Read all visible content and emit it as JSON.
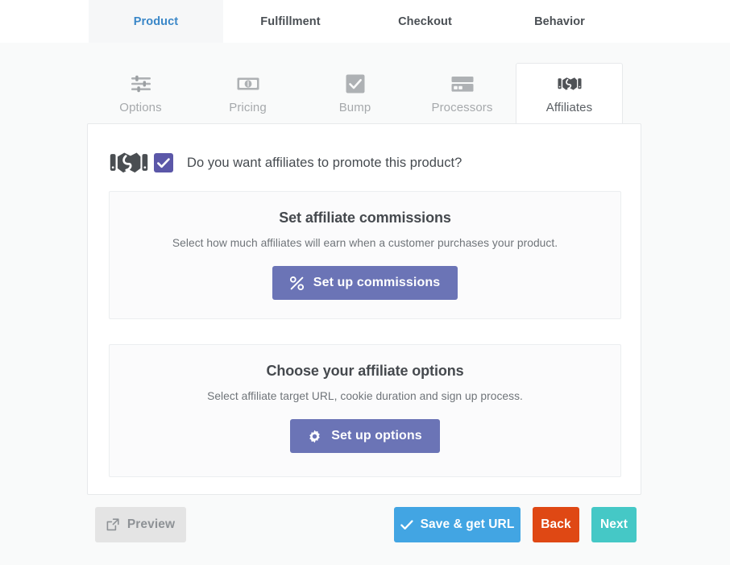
{
  "main_tabs": [
    {
      "label": "Product",
      "active": true
    },
    {
      "label": "Fulfillment",
      "active": false
    },
    {
      "label": "Checkout",
      "active": false
    },
    {
      "label": "Behavior",
      "active": false
    }
  ],
  "sub_tabs": [
    {
      "label": "Options",
      "icon": "sliders-icon",
      "active": false
    },
    {
      "label": "Pricing",
      "icon": "banknote-icon",
      "active": false
    },
    {
      "label": "Bump",
      "icon": "checkbox-icon",
      "active": false
    },
    {
      "label": "Processors",
      "icon": "credit-card-icon",
      "active": false
    },
    {
      "label": "Affiliates",
      "icon": "handshake-icon",
      "active": true
    }
  ],
  "panel": {
    "heading_icon": "handshake-icon",
    "checkbox_checked": true,
    "heading": "Do you want affiliates to promote this product?"
  },
  "cards": [
    {
      "title": "Set affiliate commissions",
      "subtitle": "Select how much affiliates will earn when a customer purchases your product.",
      "button_label": "Set up commissions",
      "button_icon": "percent-icon"
    },
    {
      "title": "Choose your affiliate options",
      "subtitle": "Select affiliate target URL, cookie duration and sign up process.",
      "button_label": "Set up options",
      "button_icon": "gear-icon"
    }
  ],
  "footer": {
    "preview_label": "Preview",
    "preview_icon": "external-link-icon",
    "save_label": "Save & get URL",
    "save_icon": "check-icon",
    "back_label": "Back",
    "next_label": "Next"
  },
  "colors": {
    "active_tab_text": "#3a87c8",
    "checkbox": "#5b57a8",
    "card_button": "#6b74b6",
    "save": "#42a5e3",
    "back": "#df4814",
    "next": "#45c8c6",
    "preview_bg": "#e4e4e4"
  }
}
